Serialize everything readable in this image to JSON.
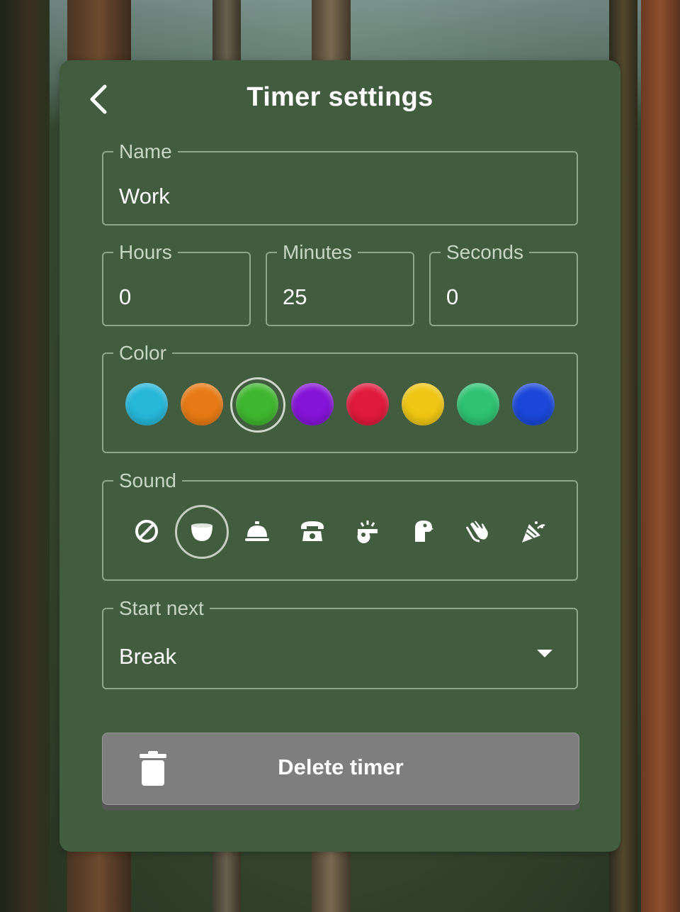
{
  "header": {
    "title": "Timer settings",
    "back_icon": "chevron-left-icon"
  },
  "name_field": {
    "label": "Name",
    "value": "Work"
  },
  "duration": {
    "hours": {
      "label": "Hours",
      "value": "0"
    },
    "minutes": {
      "label": "Minutes",
      "value": "25"
    },
    "seconds": {
      "label": "Seconds",
      "value": "0"
    }
  },
  "color_picker": {
    "label": "Color",
    "selected_index": 2,
    "swatches": [
      "#27b7d9",
      "#e77a14",
      "#3fb62f",
      "#8414d6",
      "#e01a3c",
      "#efc613",
      "#2ec272",
      "#1a47d8"
    ]
  },
  "sound_picker": {
    "label": "Sound",
    "selected_index": 1,
    "options": [
      "no-sound-icon",
      "singing-bowl-icon",
      "service-bell-icon",
      "telephone-icon",
      "whistle-icon",
      "parrot-icon",
      "clapping-hands-icon",
      "party-popper-icon"
    ]
  },
  "start_next": {
    "label": "Start next",
    "value": "Break"
  },
  "delete_button": {
    "label": "Delete timer",
    "icon": "trash-icon"
  },
  "colors": {
    "panel": "#415c3e",
    "border": "#8ea68a",
    "delete_bg": "#7e7e7e"
  }
}
